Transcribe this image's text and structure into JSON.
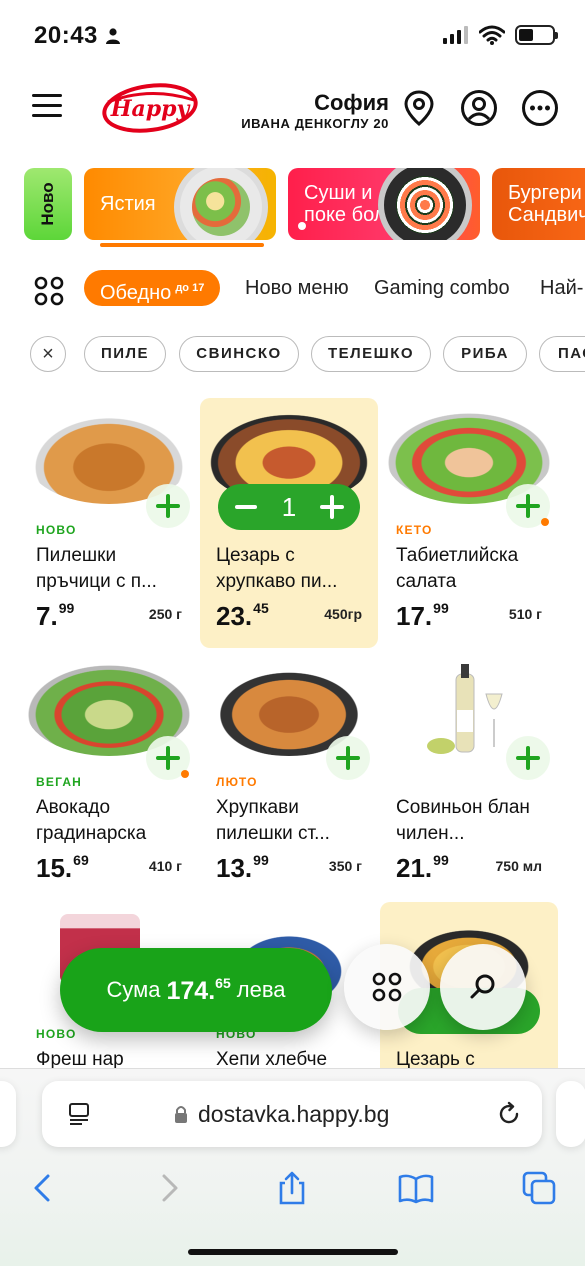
{
  "status": {
    "time": "20:43"
  },
  "header": {
    "city": "София",
    "address": "ИВАНА ДЕНКОГЛУ 20",
    "logo_text": "Happy"
  },
  "categories": [
    {
      "label": "Ново"
    },
    {
      "label": "Ястия"
    },
    {
      "label": "Суши и поке бол"
    },
    {
      "label": "Бургери Сандвичи"
    }
  ],
  "subnav": {
    "active_label": "Обедно",
    "active_sup": "до 17",
    "links": [
      "Ново меню",
      "Gaming combo",
      "Най-"
    ]
  },
  "filters": [
    "ПИЛЕ",
    "СВИНСКО",
    "ТЕЛЕШКО",
    "РИБА",
    "ПАС"
  ],
  "products": [
    {
      "tag": "НОВО",
      "name": "Пилешки пръчици с п...",
      "price_int": "7.",
      "price_dec": "99",
      "weight": "250 г"
    },
    {
      "tag": "",
      "name": "Цезарь с хрупкаво пи...",
      "price_int": "23.",
      "price_dec": "45",
      "weight": "450гр",
      "quantity": "1"
    },
    {
      "tag": "КЕТО",
      "name": "Табиетлийска салата",
      "price_int": "17.",
      "price_dec": "99",
      "weight": "510 г"
    },
    {
      "tag": "ВЕГАН",
      "name": "Авокадо градинарска",
      "price_int": "15.",
      "price_dec": "69",
      "weight": "410 г"
    },
    {
      "tag": "ЛЮТО",
      "name": "Хрупкави пилешки ст...",
      "price_int": "13.",
      "price_dec": "99",
      "weight": "350 г"
    },
    {
      "tag": "",
      "name": "Совиньон блан чилен...",
      "price_int": "21.",
      "price_dec": "99",
      "weight": "750 мл"
    },
    {
      "tag": "НОВО",
      "name": "Фреш нар"
    },
    {
      "tag": "НОВО",
      "name": "Хепи хлебче"
    },
    {
      "tag": "",
      "name": "Цезарь с"
    }
  ],
  "cart": {
    "label": "Сума",
    "total_int": "174.",
    "total_dec": "65",
    "currency": "лева"
  },
  "browser": {
    "url": "dostavka.happy.bg"
  },
  "colors": {
    "accent": "#ff7a00",
    "green": "#19a319",
    "selected_card": "#fdf0c6"
  }
}
